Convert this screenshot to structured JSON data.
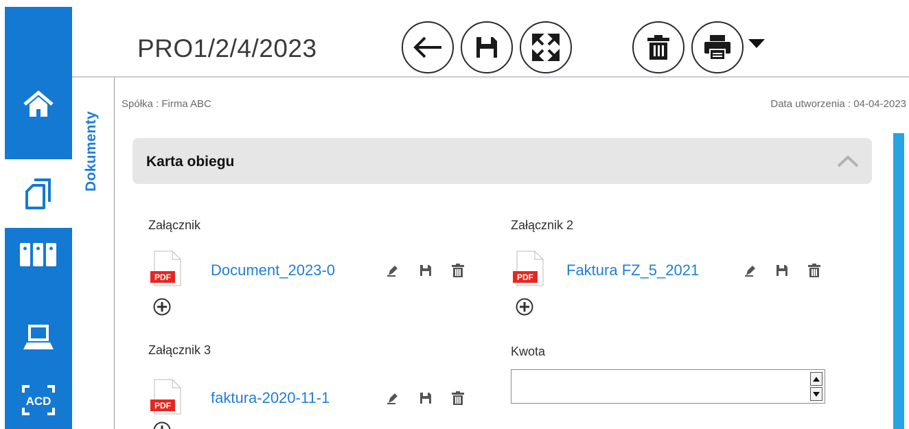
{
  "header": {
    "document_number": "PRO1/2/4/2023",
    "toolbar": {
      "back": "back-arrow-icon",
      "save": "floppy-disk-icon",
      "fullscreen": "fullscreen-icon",
      "delete": "trash-icon",
      "print": "printer-icon"
    }
  },
  "nav": {
    "items": [
      {
        "icon": "home-icon",
        "active": false
      },
      {
        "icon": "documents-icon",
        "active": true
      },
      {
        "icon": "binders-icon",
        "active": false
      },
      {
        "icon": "scanner-icon",
        "active": false
      },
      {
        "icon": "acd-ocr-icon",
        "active": false,
        "text": "ACD"
      }
    ]
  },
  "side_tab": {
    "label": "Dokumenty"
  },
  "info": {
    "company": "Spółka : Firma ABC",
    "created": "Data utworzenia : 04-04-2023"
  },
  "section": {
    "title": "Karta obiegu"
  },
  "fields": {
    "attachment_1": {
      "label": "Załącznik",
      "file": "Document_2023-0",
      "file_type": "PDF"
    },
    "attachment_2": {
      "label": "Załącznik 2",
      "file": "Faktura FZ_5_2021",
      "file_type": "PDF"
    },
    "attachment_3": {
      "label": "Załącznik 3",
      "file": "faktura-2020-11-1",
      "file_type": "PDF"
    },
    "amount": {
      "label": "Kwota",
      "value": ""
    }
  },
  "colors": {
    "nav_bg": "#1479d3",
    "accent": "#1e7ed8",
    "scrollbar": "#2aa3e3",
    "pdf_red": "#e8261f",
    "section_bg": "#e6e6e6"
  }
}
